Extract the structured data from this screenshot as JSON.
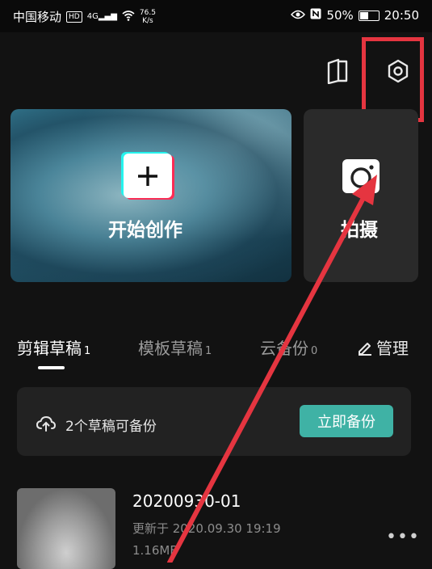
{
  "status_bar": {
    "carrier": "中国移动",
    "hd_badge": "HD",
    "signal_label": "4G",
    "net_speed_value": "76.5",
    "net_speed_unit": "K/s",
    "battery_percent": "50%",
    "time": "20:50"
  },
  "cards": {
    "create_label": "开始创作",
    "shoot_label": "拍摄"
  },
  "tabs": [
    {
      "label": "剪辑草稿",
      "count": "1"
    },
    {
      "label": "模板草稿",
      "count": "1"
    },
    {
      "label": "云备份",
      "count": "0"
    }
  ],
  "manage_label": "管理",
  "backup_banner": {
    "text": "2个草稿可备份",
    "button_label": "立即备份"
  },
  "draft": {
    "title": "20200930-01",
    "updated": "更新于 2020.09.30 19:19",
    "size": "1.16MB",
    "more": "•••"
  },
  "colors": {
    "annotation_red": "#e53540",
    "accent_teal": "#3fb2a5"
  }
}
